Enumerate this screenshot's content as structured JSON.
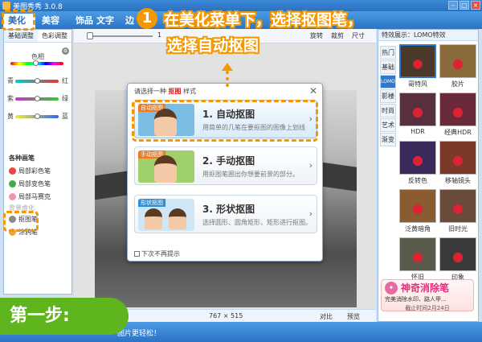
{
  "window": {
    "title": "美图秀秀 3.0.8"
  },
  "tabs": [
    {
      "label": "美化",
      "active": true
    },
    {
      "label": "美容"
    },
    {
      "label": "饰品"
    },
    {
      "label": "文字"
    },
    {
      "label": "边"
    }
  ],
  "left_panel": {
    "subtabs": [
      "基础调整",
      "色彩调整"
    ],
    "sliders": [
      {
        "label": "色相"
      },
      {
        "left": "青",
        "right": "红"
      },
      {
        "left": "紫",
        "right": "绿"
      },
      {
        "left": "黄",
        "right": "蓝"
      }
    ],
    "brushes_title": "各种画笔",
    "brushes": [
      "局部彩色笔",
      "局部变色笔",
      "局部马赛克",
      "抠图笔",
      "涂鸦笔"
    ],
    "brush_partial": "背景虚化"
  },
  "toolbar": {
    "zoom_value": "1",
    "rotate_label": "旋转",
    "crop_label": "裁剪",
    "size_label": "尺寸"
  },
  "dialog": {
    "header_prefix": "请选择一种",
    "header_keyword": "抠图",
    "header_suffix": "样式",
    "options": [
      {
        "tag": "自动抠图",
        "title": "1. 自动抠图",
        "desc": "用简单的几笔在要抠图的图像上划线",
        "selected": true
      },
      {
        "tag": "手动抠图",
        "title": "2. 手动抠图",
        "desc": "用抠图笔圈出你想要前景的部分。"
      },
      {
        "tag": "形状抠图",
        "title": "3. 形状抠图",
        "desc": "选择圆形、圆角矩形，矩形进行抠图。"
      }
    ],
    "dont_show": "下次不再提示"
  },
  "right_panel": {
    "header": "特效展示：LOMO特效",
    "categories": [
      "热门",
      "基础",
      "LOMO",
      "影楼",
      "时尚",
      "艺术",
      "渐变"
    ],
    "active_category": "LOMO",
    "effects": [
      {
        "label": "哥特风",
        "selected": true,
        "color": "#4b3a2a"
      },
      {
        "label": "胶片",
        "color": "#8a6a3a"
      },
      {
        "label": "HDR",
        "color": "#5a3040"
      },
      {
        "label": "经典HDR",
        "color": "#6a2a3a"
      },
      {
        "label": "反转色",
        "color": "#3a2a5a"
      },
      {
        "label": "移轴镜头",
        "color": "#7a3a2a"
      },
      {
        "label": "泛黄暗角",
        "color": "#8a5a30"
      },
      {
        "label": "旧时光",
        "color": "#6a4a3a"
      },
      {
        "label": "怀旧",
        "color": "#5a5a4a"
      },
      {
        "label": "印象",
        "color": "#3a3a3a"
      }
    ]
  },
  "ad": {
    "title": "神奇消除笔",
    "sub": "完美消除水印、路人甲...",
    "date": "截止时间2月24日"
  },
  "status": {
    "size": "767 × 515",
    "compare": "对比",
    "preview": "预览"
  },
  "bottom": {
    "text": "图片更轻松！"
  },
  "annotation": {
    "step": "第一步:",
    "number": "1",
    "line1": "在美化菜单下，选择抠图笔，",
    "line2": "选择自动抠图"
  }
}
